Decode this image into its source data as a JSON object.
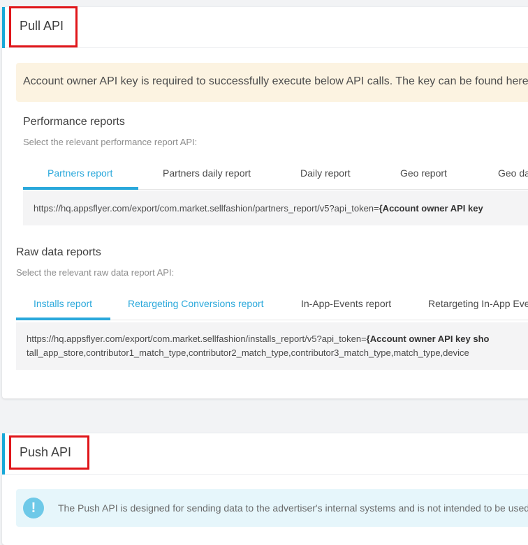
{
  "pull": {
    "title": "Pull API",
    "alert": "Account owner API key is required to successfully execute below API calls. The key can be found here",
    "performance": {
      "title": "Performance reports",
      "subtitle": "Select the relevant performance report API:",
      "tabs": [
        "Partners report",
        "Partners daily report",
        "Daily report",
        "Geo report",
        "Geo da"
      ],
      "url_prefix": "https://hq.appsflyer.com/export/com.market.sellfashion/partners_report/v5?api_token=",
      "url_key": "{Account owner API key"
    },
    "raw": {
      "title": "Raw data reports",
      "subtitle": "Select the relevant raw data report API:",
      "tabs": [
        "Installs report",
        "Retargeting Conversions report",
        "In-App-Events report",
        "Retargeting In-App Eve"
      ],
      "url_prefix": "https://hq.appsflyer.com/export/com.market.sellfashion/installs_report/v5?api_token=",
      "url_key": "{Account owner API key sho",
      "url_line2": "tall_app_store,contributor1_match_type,contributor2_match_type,contributor3_match_type,match_type,device"
    }
  },
  "push": {
    "title": "Push API",
    "info_icon": "exclamation-icon",
    "alert": "The Push API is designed for sending data to the advertiser's internal systems and is not intended to be used"
  },
  "colors": {
    "accent": "#18a8d8",
    "tab_active": "#2aa8db",
    "highlight": "#e01519"
  }
}
